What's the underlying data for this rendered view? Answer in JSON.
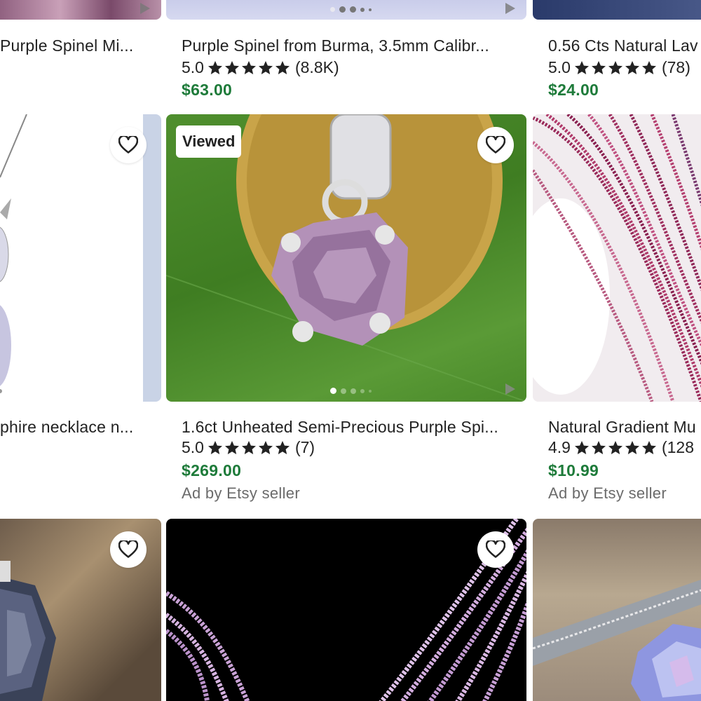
{
  "colors": {
    "price": "#1e7b3a",
    "text": "#222222",
    "muted": "#6b6b6b"
  },
  "row1": [
    {
      "title": "Purple Spinel Mi...",
      "rating": "",
      "count": "",
      "price": ""
    },
    {
      "title": "Purple Spinel from Burma, 3.5mm Calibr...",
      "rating": "5.0",
      "count": "(8.8K)",
      "price": "$63.00"
    },
    {
      "title": "0.56 Cts  Natural Lav",
      "rating": "5.0",
      "count": "(78)",
      "price": "$24.00"
    }
  ],
  "row2": [
    {
      "title": "phire necklace n...",
      "heart": "heart-outline-icon"
    },
    {
      "title": "1.6ct Unheated Semi-Precious Purple Spi...",
      "rating": "5.0",
      "count": "(7)",
      "price": "$269.00",
      "ad": "Ad by Etsy seller",
      "badge": "Viewed",
      "heart": "heart-outline-icon"
    },
    {
      "title": "Natural Gradient Mu",
      "rating": "4.9",
      "count": "(128",
      "price": "$10.99",
      "ad": "Ad by Etsy seller"
    }
  ],
  "row3": [
    {
      "heart": "heart-outline-icon"
    },
    {
      "heart": "heart-outline-icon"
    },
    {}
  ],
  "icons": {
    "star": "star-icon",
    "heart": "heart-outline-icon",
    "play": "play-icon"
  }
}
